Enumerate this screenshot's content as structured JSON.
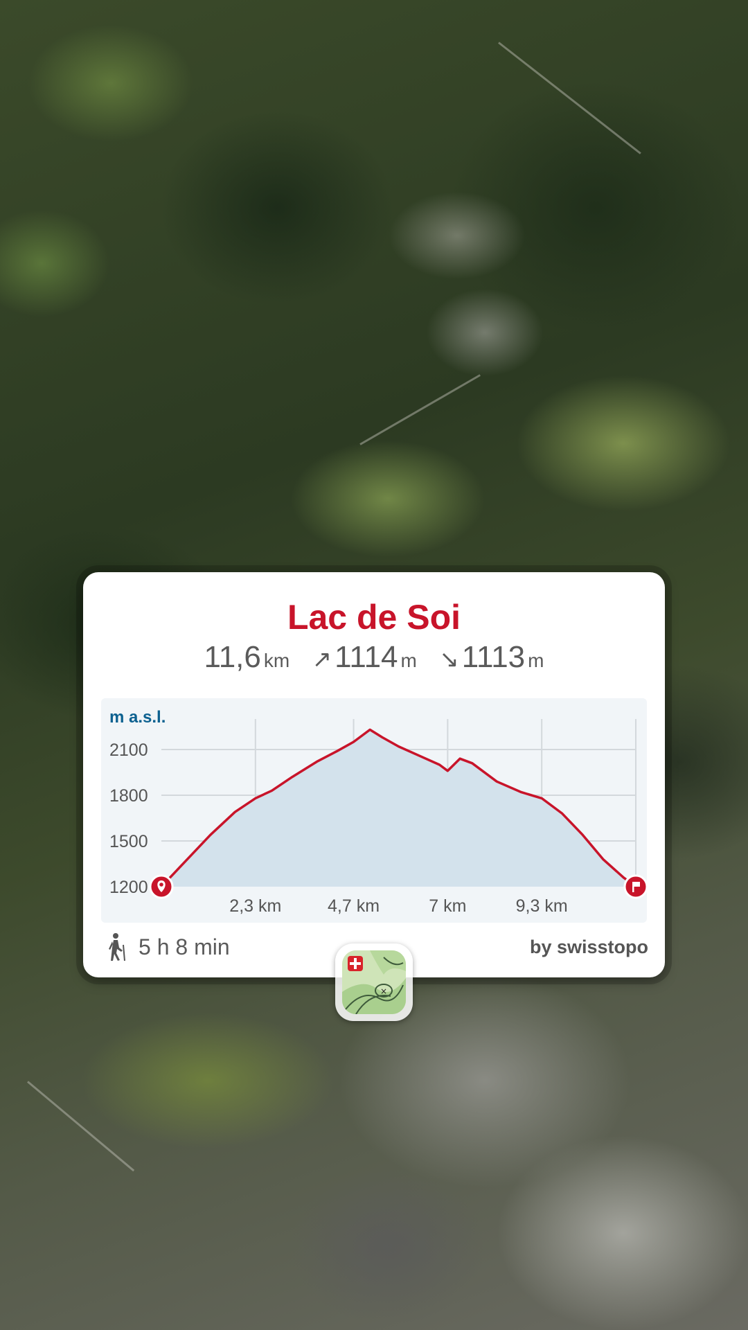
{
  "route": {
    "title": "Lac de Soi",
    "distance_value": "11,6",
    "distance_unit": "km",
    "ascent_arrow": "↗",
    "ascent_value": "1114",
    "ascent_unit": "m",
    "descent_arrow": "↘",
    "descent_value": "1113",
    "descent_unit": "m",
    "duration": "5 h 8 min",
    "credit": "by swisstopo"
  },
  "icons": {
    "hike": "hiker-icon",
    "start": "start-pin-icon",
    "end": "finish-flag-icon",
    "app": "swisstopo-app-icon"
  },
  "colors": {
    "accent": "#c8142a",
    "profile_fill": "#d3e2ec",
    "axis_label": "#0d6190"
  },
  "chart_data": {
    "type": "area",
    "ylabel": "m a.s.l.",
    "yticks": [
      "2100",
      "1800",
      "1500",
      "1200"
    ],
    "xticks": [
      "2,3 km",
      "4,7 km",
      "7 km",
      "9,3 km"
    ],
    "xlim": [
      0,
      11.6
    ],
    "ylim": [
      1200,
      2300
    ],
    "grid": true,
    "series": [
      {
        "x": [
          0,
          0.6,
          1.2,
          1.8,
          2.3,
          2.7,
          3.2,
          3.8,
          4.3,
          4.7,
          5.1,
          5.4,
          5.8,
          6.3,
          6.8,
          7.0,
          7.3,
          7.6,
          8.2,
          8.8,
          9.3,
          9.8,
          10.3,
          10.8,
          11.3,
          11.6
        ],
        "y": [
          1200,
          1370,
          1540,
          1690,
          1780,
          1830,
          1920,
          2020,
          2090,
          2150,
          2230,
          2180,
          2120,
          2060,
          2000,
          1960,
          2040,
          2010,
          1890,
          1820,
          1780,
          1680,
          1540,
          1380,
          1260,
          1200
        ]
      }
    ]
  }
}
